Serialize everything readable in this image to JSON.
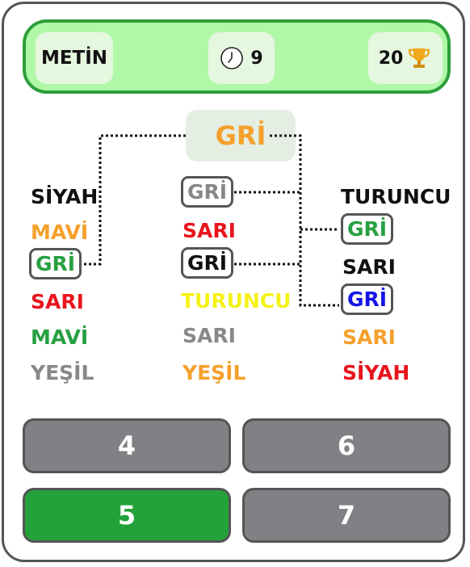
{
  "header": {
    "player_name": "METİN",
    "timer_value": "9",
    "timer_icon": "clock-icon",
    "score_value": "20",
    "score_icon": "trophy-icon"
  },
  "center_word": "GRİ",
  "columns": [
    {
      "words": [
        {
          "text": "SİYAH",
          "color": "#111111",
          "boxed": false
        },
        {
          "text": "MAVİ",
          "color": "#f5a02c",
          "boxed": false
        },
        {
          "text": "GRİ",
          "color": "#27a040",
          "boxed": true
        },
        {
          "text": "SARI",
          "color": "#e8141c",
          "boxed": false
        },
        {
          "text": "MAVİ",
          "color": "#27a040",
          "boxed": false
        },
        {
          "text": "YEŞİL",
          "color": "#888888",
          "boxed": false
        }
      ]
    },
    {
      "words": [
        {
          "text": "GRİ",
          "color": "#888888",
          "boxed": true
        },
        {
          "text": "SARI",
          "color": "#e8141c",
          "boxed": false
        },
        {
          "text": "GRİ",
          "color": "#111111",
          "boxed": true
        },
        {
          "text": "TURUNCU",
          "color": "#f5f219",
          "boxed": false
        },
        {
          "text": "SARI",
          "color": "#888888",
          "boxed": false
        },
        {
          "text": "YEŞİL",
          "color": "#f5a02c",
          "boxed": false
        }
      ]
    },
    {
      "words": [
        {
          "text": "TURUNCU",
          "color": "#111111",
          "boxed": false
        },
        {
          "text": "GRİ",
          "color": "#27a040",
          "boxed": true
        },
        {
          "text": "SARI",
          "color": "#111111",
          "boxed": false
        },
        {
          "text": "GRİ",
          "color": "#1414e8",
          "boxed": true
        },
        {
          "text": "SARI",
          "color": "#f5a02c",
          "boxed": false
        },
        {
          "text": "SİYAH",
          "color": "#e8141c",
          "boxed": false
        }
      ]
    }
  ],
  "answers": [
    {
      "label": "4",
      "state": "default"
    },
    {
      "label": "6",
      "state": "default"
    },
    {
      "label": "5",
      "state": "selected"
    },
    {
      "label": "7",
      "state": "default"
    }
  ]
}
